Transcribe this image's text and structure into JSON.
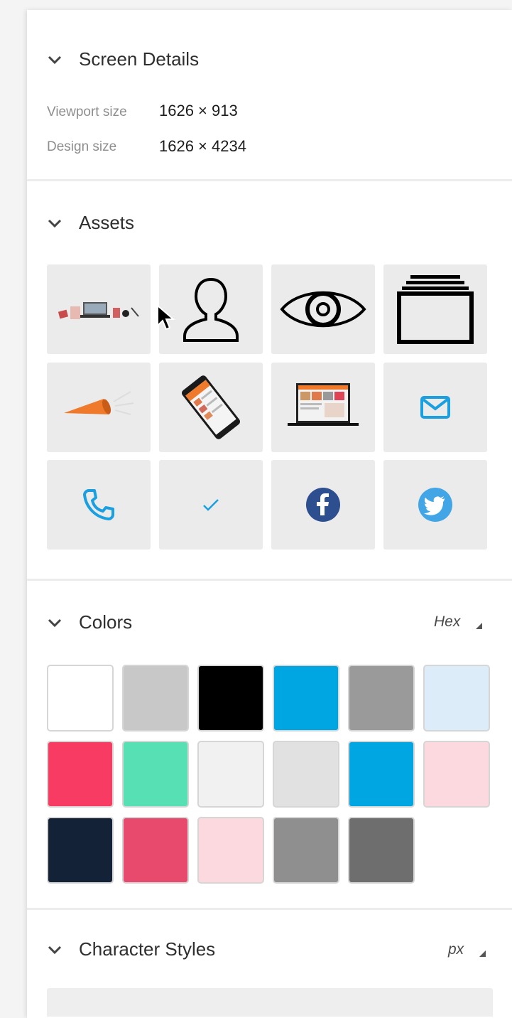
{
  "screen_details": {
    "title": "Screen Details",
    "viewport_label": "Viewport size",
    "viewport_value": "1626 × 913",
    "design_label": "Design size",
    "design_value": "1626 × 4234"
  },
  "assets": {
    "title": "Assets",
    "items": [
      {
        "name": "desk-flatlay-image"
      },
      {
        "name": "user-icon"
      },
      {
        "name": "eye-icon"
      },
      {
        "name": "stacked-frames-icon"
      },
      {
        "name": "megaphone-image"
      },
      {
        "name": "phone-mockup-image"
      },
      {
        "name": "laptop-mockup-image"
      },
      {
        "name": "mail-icon"
      },
      {
        "name": "phone-icon"
      },
      {
        "name": "checkmark-icon"
      },
      {
        "name": "facebook-icon"
      },
      {
        "name": "twitter-icon"
      }
    ]
  },
  "colors": {
    "title": "Colors",
    "format": "Hex",
    "swatches": [
      "#ffffff",
      "#c8c8c8",
      "#000000",
      "#00a6e2",
      "#9a9a9a",
      "#dcecf8",
      "#f73b62",
      "#56e0b4",
      "#f1f1f1",
      "#e1e1e1",
      "#00a6e2",
      "#fcd9de",
      "#142238",
      "#e84a6d",
      "#fcd9de",
      "#8f8f8f",
      "#6e6e6e"
    ]
  },
  "character_styles": {
    "title": "Character Styles",
    "unit": "px"
  }
}
